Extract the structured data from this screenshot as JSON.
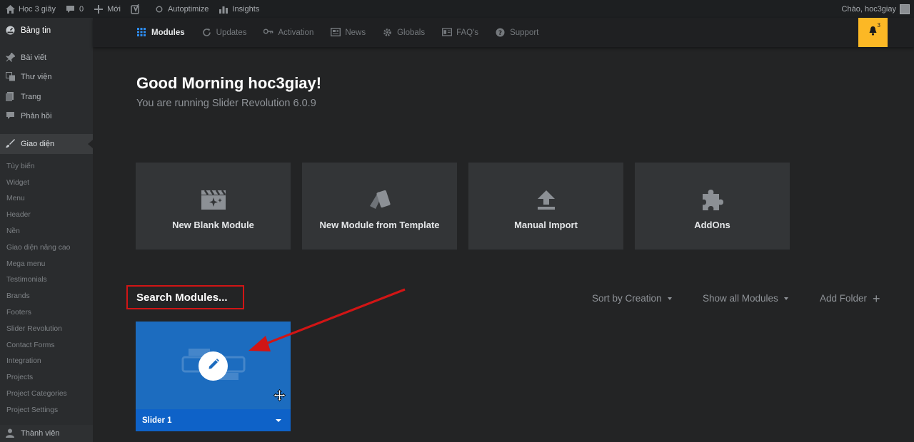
{
  "adminbar": {
    "site_name": "Học 3 giây",
    "comments_count": "0",
    "new_label": "Mới",
    "autoptimize_label": "Autoptimize",
    "insights_label": "Insights",
    "greeting": "Chào, hoc3giay",
    "icons": [
      "home-icon",
      "comment-icon",
      "plus-icon",
      "yoast-icon",
      "circle-icon",
      "bar-chart-icon",
      "avatar"
    ]
  },
  "sidebar": {
    "dashboard": "Bảng tin",
    "items": [
      {
        "label": "Bài viết",
        "icon": "pin-icon"
      },
      {
        "label": "Thư viện",
        "icon": "media-icon"
      },
      {
        "label": "Trang",
        "icon": "page-icon"
      },
      {
        "label": "Phản hồi",
        "icon": "comment-icon"
      }
    ],
    "active": "Giao diện",
    "subitems": [
      "Tùy biến",
      "Widget",
      "Menu",
      "Header",
      "Nền",
      "Giao diện nâng cao",
      "Mega menu",
      "Testimonials",
      "Brands",
      "Footers",
      "Slider Revolution",
      "Contact Forms",
      "Integration",
      "Projects",
      "Project Categories",
      "Project Settings"
    ],
    "bottom": "Thành viên"
  },
  "topnav": {
    "items": [
      {
        "label": "Modules",
        "icon": "grid-icon"
      },
      {
        "label": "Updates",
        "icon": "refresh-icon"
      },
      {
        "label": "Activation",
        "icon": "key-icon"
      },
      {
        "label": "News",
        "icon": "newspaper-icon"
      },
      {
        "label": "Globals",
        "icon": "gear-icon"
      },
      {
        "label": "FAQ's",
        "icon": "faq-icon"
      },
      {
        "label": "Support",
        "icon": "help-icon"
      }
    ],
    "notifications": "3",
    "bell_color": "#fcb825"
  },
  "main": {
    "greeting": "Good Morning hoc3giay!",
    "version": "You are running Slider Revolution 6.0.9",
    "cards": [
      {
        "label": "New Blank Module",
        "icon": "clapperboard-sparkle-icon"
      },
      {
        "label": "New Module from Template",
        "icon": "template-cards-icon"
      },
      {
        "label": "Manual Import",
        "icon": "upload-icon"
      },
      {
        "label": "AddOns",
        "icon": "puzzle-icon"
      }
    ],
    "search_placeholder": "Search Modules...",
    "sort_label": "Sort by Creation",
    "filter_label": "Show all Modules",
    "add_folder_label": "Add Folder",
    "module": {
      "title": "Slider 1",
      "color": "#1c6cbf"
    }
  },
  "colors": {
    "bg": "#232425",
    "highlight": "#d11515"
  }
}
